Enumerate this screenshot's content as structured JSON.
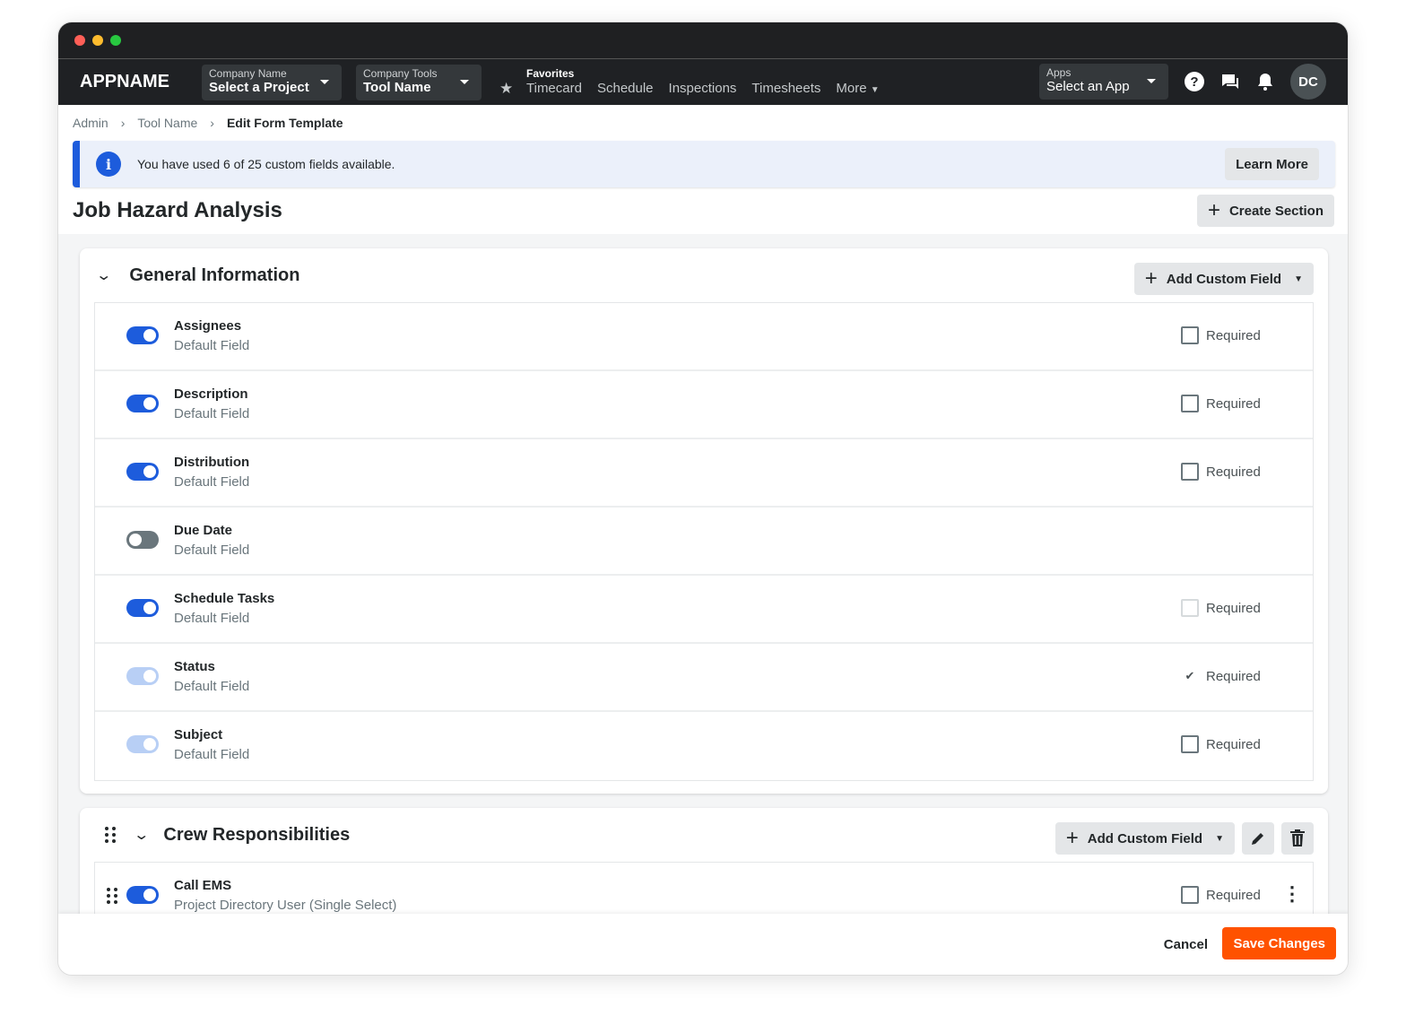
{
  "nav": {
    "app_name": "APPNAME",
    "project": {
      "label": "Company Name",
      "value": "Select a Project"
    },
    "tool": {
      "label": "Company Tools",
      "value": "Tool Name"
    },
    "favorites_label": "Favorites",
    "favorites": [
      "Timecard",
      "Schedule",
      "Inspections",
      "Timesheets"
    ],
    "more": "More",
    "apps": {
      "label": "Apps",
      "value": "Select an App"
    },
    "avatar": "DC"
  },
  "breadcrumb": [
    "Admin",
    "Tool Name",
    "Edit Form Template"
  ],
  "banner": {
    "text": "You have used 6 of 25 custom fields available.",
    "button": "Learn More"
  },
  "page": {
    "title": "Job Hazard Analysis",
    "create_section": "Create Section"
  },
  "sections": [
    {
      "title": "General Information",
      "add_field": "Add Custom Field",
      "fields": [
        {
          "name": "Assignees",
          "type": "Default Field",
          "toggle": "on",
          "required": "unchecked",
          "required_label": "Required"
        },
        {
          "name": "Description",
          "type": "Default Field",
          "toggle": "on",
          "required": "unchecked",
          "required_label": "Required"
        },
        {
          "name": "Distribution",
          "type": "Default Field",
          "toggle": "on",
          "required": "unchecked",
          "required_label": "Required"
        },
        {
          "name": "Due Date",
          "type": "Default Field",
          "toggle": "off",
          "required": "none",
          "required_label": ""
        },
        {
          "name": "Schedule Tasks",
          "type": "Default Field",
          "toggle": "on",
          "required": "disabled",
          "required_label": "Required"
        },
        {
          "name": "Status",
          "type": "Default Field",
          "toggle": "disabled-on",
          "required": "checked-locked",
          "required_label": "Required"
        },
        {
          "name": "Subject",
          "type": "Default Field",
          "toggle": "disabled-on",
          "required": "unchecked",
          "required_label": "Required"
        }
      ]
    },
    {
      "title": "Crew Responsibilities",
      "add_field": "Add Custom Field",
      "fields": [
        {
          "name": "Call EMS",
          "type": "Project Directory User (Single Select)",
          "toggle": "on",
          "required": "unchecked",
          "required_label": "Required"
        }
      ]
    }
  ],
  "footer": {
    "cancel": "Cancel",
    "save": "Save Changes"
  },
  "colors": {
    "accent": "#1d5cdc",
    "save": "#ff5200",
    "toggle_off": "#6a767c",
    "toggle_disabled": "#b8cff5"
  }
}
